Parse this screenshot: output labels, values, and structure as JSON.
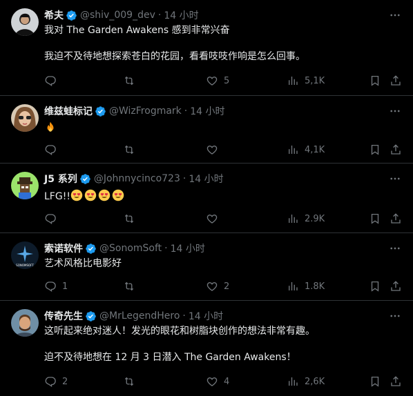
{
  "posts": [
    {
      "name": "希夫",
      "handle": "@shiv_009_dev",
      "dot": "·",
      "time": "14 小时",
      "lines": [
        "我对 The Garden Awakens 感到非常兴奋",
        "",
        "我迫不及待地想探索苍白的花园，看看吱吱作响是怎么回事。"
      ],
      "replies": "",
      "reposts": "",
      "likes": "5",
      "views": "5,1K"
    },
    {
      "name": "维兹蛙标记",
      "handle": "@WizFrogmark",
      "dot": "·",
      "time": "14 小时",
      "emoji": "fire",
      "replies": "",
      "reposts": "",
      "likes": "",
      "views": "4,1K"
    },
    {
      "name": "J5 系列",
      "handle": "@Johnnycinco723",
      "dot": "·",
      "time": "14 小时",
      "text_prefix": "LFG!!",
      "emoji_count": 4,
      "emoji": "heart-eyes",
      "replies": "",
      "reposts": "",
      "likes": "",
      "views": "2.9K"
    },
    {
      "name": "索诺软件",
      "handle": "@SonomSoft",
      "dot": "·",
      "time": "14 小时",
      "avatar_text": "SONOMSOFT",
      "lines": [
        "艺术风格比电影好"
      ],
      "replies": "1",
      "reposts": "",
      "likes": "2",
      "views": "1.8K"
    },
    {
      "name": "传奇先生",
      "handle": "@MrLegendHero",
      "dot": "·",
      "time": "14 小时",
      "lines": [
        "这听起来绝对迷人！发光的眼花和树脂块创作的想法非常有趣。",
        "",
        "迫不及待地想在 12 月 3 日潜入 The Garden Awakens！"
      ],
      "replies": "2",
      "reposts": "",
      "likes": "4",
      "views": "2,6K"
    }
  ],
  "icons": {
    "verified": "verified-badge-icon",
    "more": "more-icon",
    "reply": "reply-icon",
    "repost": "repost-icon",
    "like": "like-icon",
    "views": "views-icon",
    "bookmark": "bookmark-icon",
    "share": "share-icon"
  },
  "colors": {
    "background": "#000000",
    "text": "#e7e9ea",
    "muted": "#71767b",
    "verified": "#1d9bf0",
    "divider": "#2f3336"
  }
}
